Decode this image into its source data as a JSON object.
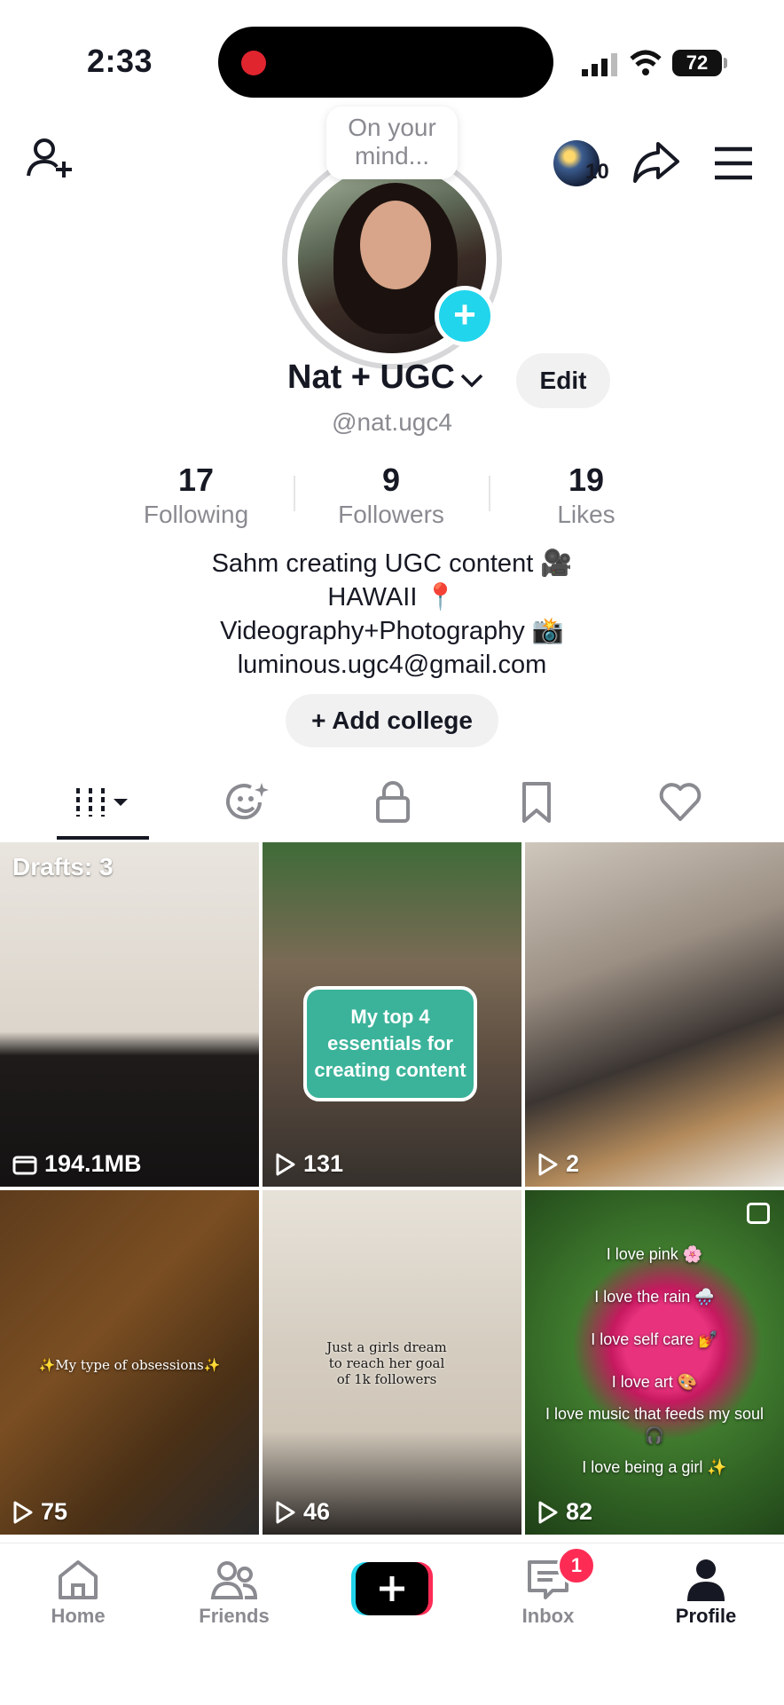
{
  "status_bar": {
    "time": "2:33",
    "battery": "72"
  },
  "header": {
    "story_count": "10",
    "bubble_text": "On your mind..."
  },
  "profile": {
    "name": "Nat + UGC",
    "edit_label": "Edit",
    "handle": "@nat.ugc4",
    "stats": [
      {
        "value": "17",
        "label": "Following"
      },
      {
        "value": "9",
        "label": "Followers"
      },
      {
        "value": "19",
        "label": "Likes"
      }
    ],
    "bio": [
      "Sahm creating UGC content 🎥",
      "HAWAII 📍",
      "Videography+Photography 📸",
      "luminous.ugc4@gmail.com"
    ],
    "add_college_label": "+ Add college"
  },
  "grid": {
    "drafts_label": "Drafts: 3",
    "items": [
      {
        "count": "194.1MB",
        "count_icon": "folder-icon"
      },
      {
        "count": "131",
        "count_icon": "play-icon",
        "overlay": "My top 4 essentials for creating content"
      },
      {
        "count": "2",
        "count_icon": "play-icon"
      },
      {
        "count": "75",
        "count_icon": "play-icon",
        "overlay": "✨My type of obsessions✨"
      },
      {
        "count": "46",
        "count_icon": "play-icon",
        "overlay": "Just a girls dream to reach her goal of 1k followers"
      },
      {
        "count": "82",
        "count_icon": "play-icon",
        "overlay_lines": [
          "I love pink 🌸",
          "I love the rain 🌧️",
          "I love self care 💅",
          "I love art 🎨",
          "I love music that feeds my soul 🎧",
          "I love being a girl ✨"
        ]
      }
    ]
  },
  "nav": {
    "home": "Home",
    "friends": "Friends",
    "inbox": "Inbox",
    "inbox_badge": "1",
    "profile": "Profile"
  },
  "colors": {
    "accent_cyan": "#20d5ec",
    "accent_red": "#fe2c55",
    "text_primary": "#161823",
    "text_secondary": "#8a8b91"
  }
}
